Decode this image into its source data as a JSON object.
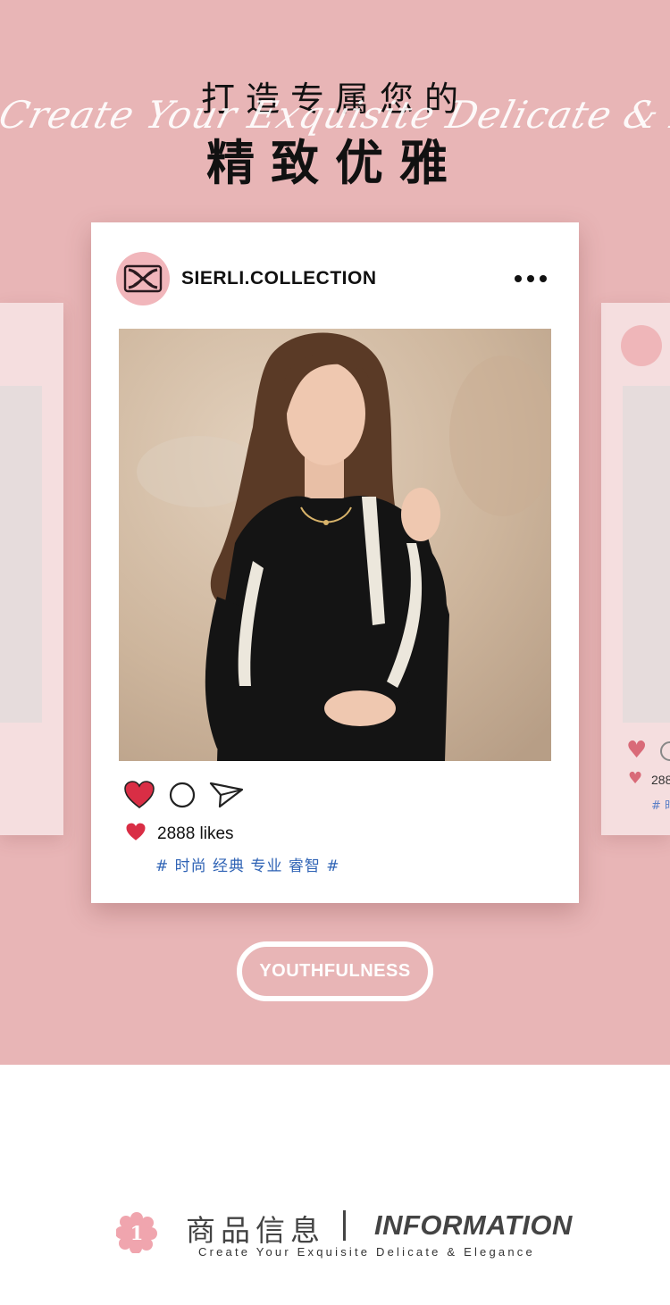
{
  "header": {
    "title_line1": "打造专属您的",
    "script_en": "Create Your Exquisite Delicate & Elegance",
    "title_line2": "精致优雅"
  },
  "post": {
    "account_name": "SIERLI.COLLECTION",
    "avatar_icon": "brand-logo-icon",
    "more_icon": "more-dots-icon",
    "like_icon": "heart-icon",
    "comment_icon": "comment-circle-icon",
    "share_icon": "send-icon",
    "likes": "2888 likes",
    "tags": "# 时尚 经典 专业 睿智 #"
  },
  "side_card_right": {
    "likes_partial": "288",
    "tags_partial": "# 时"
  },
  "cta": {
    "label": "YOUTHFULNESS"
  },
  "info": {
    "step_number": "1",
    "title_cn": "商品信息",
    "title_en": "INFORMATION",
    "subtitle": "Create Your Exquisite Delicate & Elegance"
  },
  "colors": {
    "background_pink": "#e8b5b6",
    "heart_red": "#d92e45",
    "tag_blue": "#2f63b5",
    "avatar_pink": "#f1b6bb"
  }
}
